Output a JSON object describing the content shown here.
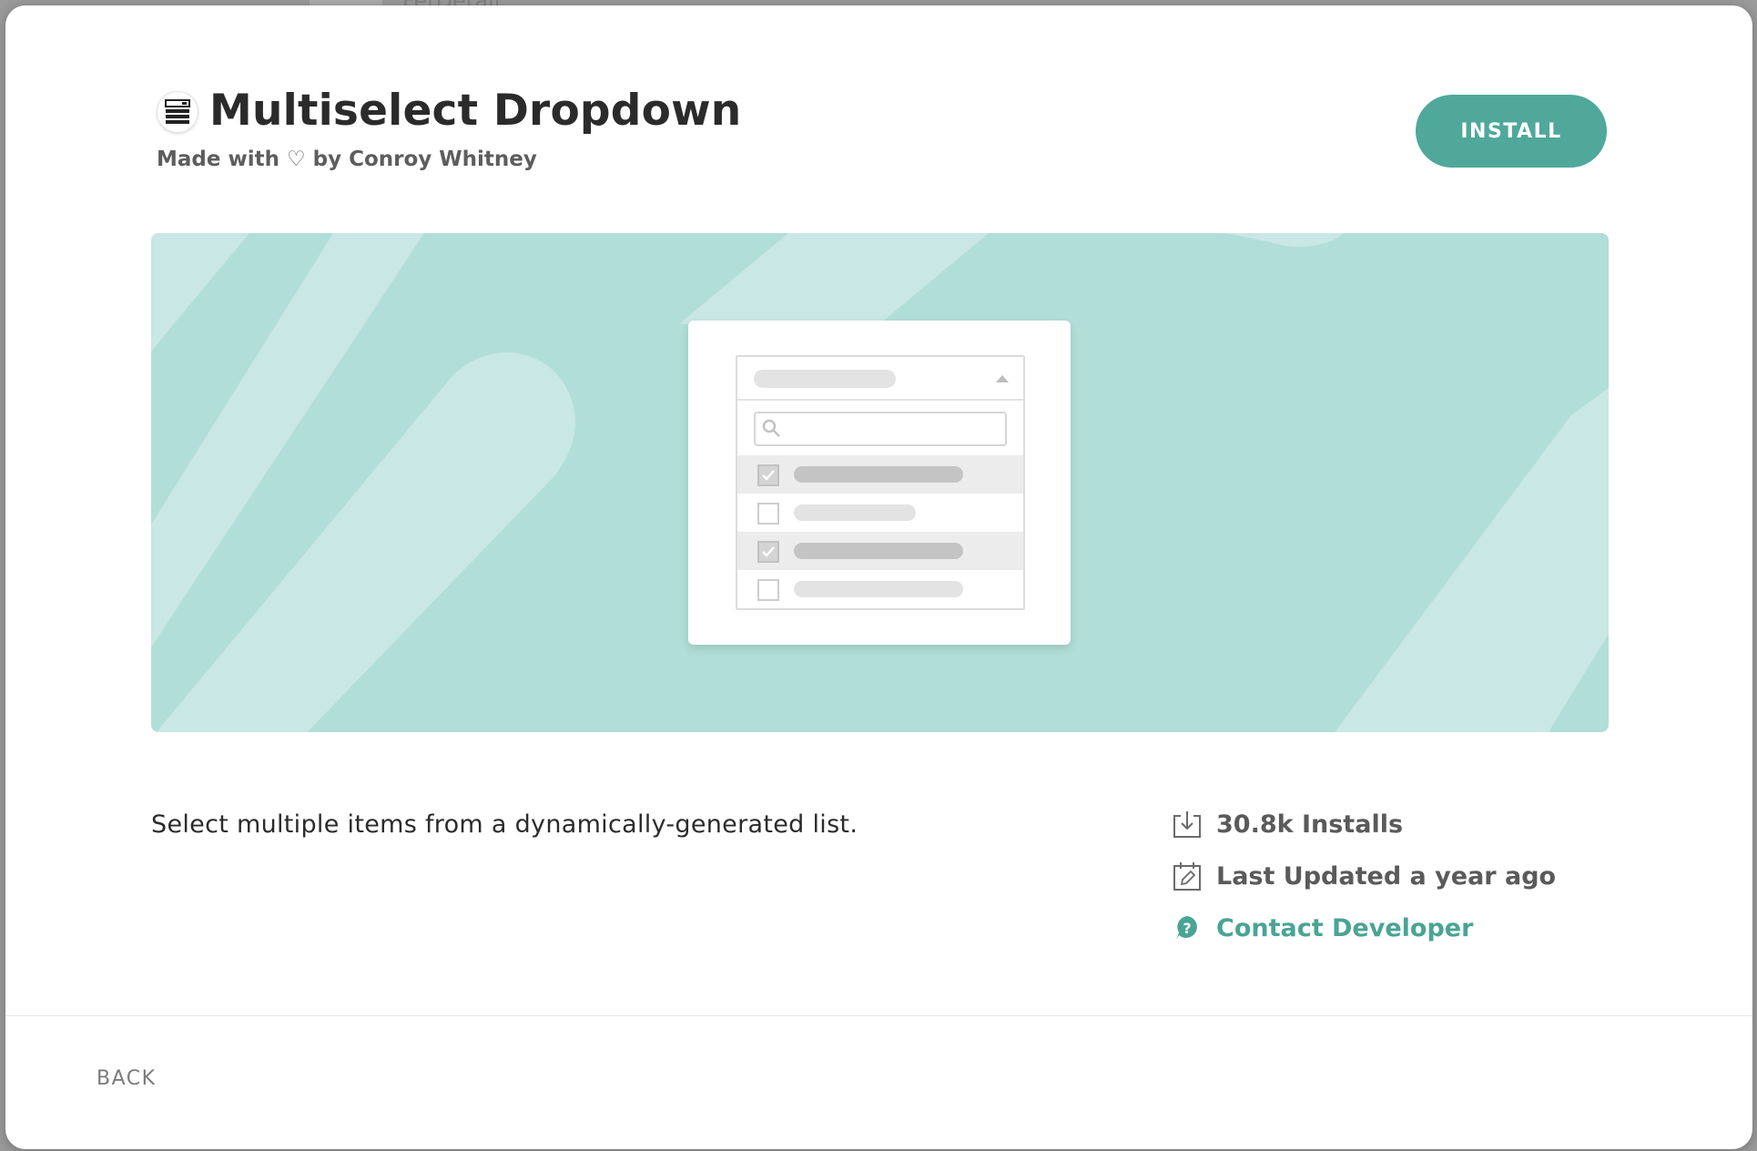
{
  "background_peek": {
    "label": "FetDetail"
  },
  "header": {
    "app_icon": "multiselect-list-icon",
    "title": "Multiselect Dropdown",
    "subtitle": "Made with ♡ by Conroy Whitney",
    "install_label": "INSTALL"
  },
  "banner": {
    "background_color": "#b1ded8",
    "preview": "multiselect-dropdown-illustration",
    "preview_rows": [
      {
        "checked": true
      },
      {
        "checked": false
      },
      {
        "checked": true
      },
      {
        "checked": false
      }
    ]
  },
  "description": "Select multiple items from a dynamically-generated list.",
  "stats": {
    "installs": {
      "icon": "download-icon",
      "label": "30.8k Installs"
    },
    "updated": {
      "icon": "calendar-edit-icon",
      "label": "Last Updated a year ago"
    },
    "contact": {
      "icon": "help-circle-icon",
      "label": "Contact Developer"
    }
  },
  "footer": {
    "back_label": "BACK"
  },
  "colors": {
    "accent": "#4fa899",
    "link": "#4aa494",
    "banner": "#b1ded8",
    "banner_stripes": "#c9e7e4"
  }
}
